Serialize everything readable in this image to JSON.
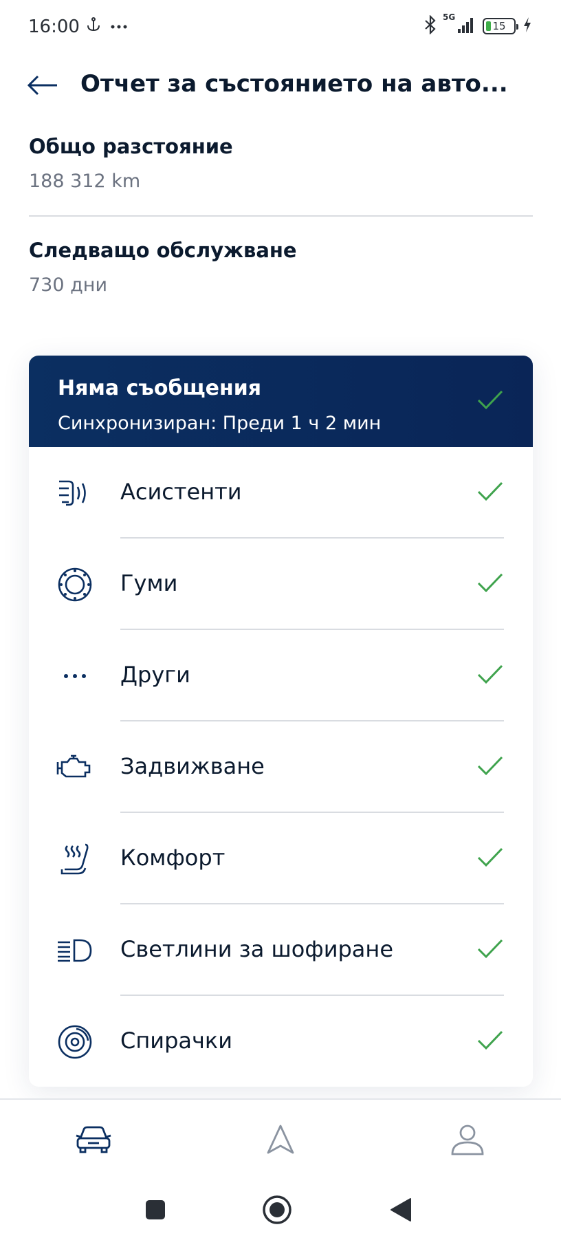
{
  "status_bar": {
    "time": "16:00",
    "network": "5G",
    "battery": "15",
    "icons": [
      "usb-anchor-icon",
      "more-dots-icon",
      "bluetooth-icon",
      "signal-icon",
      "battery-icon",
      "charging-bolt-icon"
    ]
  },
  "header": {
    "title": "Отчет за състоянието на авто...",
    "back_icon": "arrow-left-icon"
  },
  "total_distance": {
    "label": "Общо разстояние",
    "value": "188 312 km"
  },
  "next_service": {
    "label": "Следващо обслужване",
    "value": "730 дни"
  },
  "status_card": {
    "title": "Няма съобщения",
    "subtitle": "Синхронизиран: Преди 1 ч 2 мин",
    "items": [
      {
        "label": "Асистенти",
        "icon": "assist-radar-icon"
      },
      {
        "label": "Гуми",
        "icon": "tire-icon"
      },
      {
        "label": "Други",
        "icon": "more-dots-icon"
      },
      {
        "label": "Задвижване",
        "icon": "engine-icon"
      },
      {
        "label": "Комфорт",
        "icon": "heated-seat-icon"
      },
      {
        "label": "Светлини за шофиране",
        "icon": "headlight-icon"
      },
      {
        "label": "Спирачки",
        "icon": "brake-disc-icon"
      }
    ]
  },
  "bottom_nav": [
    "car-icon",
    "navigation-icon",
    "profile-icon"
  ],
  "system_nav": [
    "recents-icon",
    "home-icon",
    "back-icon"
  ],
  "colors": {
    "primary_dark": "#0b2f61",
    "check_green": "#3fa34d",
    "text_dark": "#0b1a2e",
    "text_muted": "#6b7280",
    "icon_navy": "#0b2f61"
  }
}
